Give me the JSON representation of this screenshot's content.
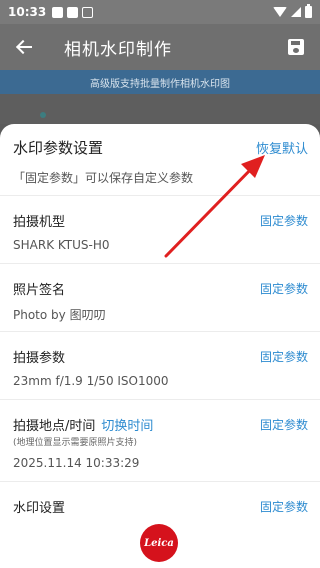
{
  "status_bar": {
    "time": "10:33",
    "icons": [
      "notification-icon",
      "notification-icon",
      "a-icon",
      "wifi-icon",
      "signal-icon",
      "battery-icon"
    ]
  },
  "app_bar": {
    "title": "相机水印制作",
    "icons": [
      "back-arrow-icon",
      "save-icon"
    ]
  },
  "banner": {
    "text": "高级版支持批量制作相机水印图"
  },
  "sheet": {
    "title": "水印参数设置",
    "restore_label": "恢复默认",
    "subtitle": "「固定参数」可以保存自定义参数",
    "rows": [
      {
        "label": "拍摄机型",
        "value": "SHARK KTUS-H0",
        "action": "固定参数"
      },
      {
        "label": "照片签名",
        "value": "Photo by 图叨叨",
        "action": "固定参数"
      },
      {
        "label": "拍摄参数",
        "value": "23mm f/1.9 1/50 ISO1000",
        "action": "固定参数"
      },
      {
        "label": "拍摄地点/时间",
        "inline_link": "切换时间",
        "note": "(地理位置显示需要原照片支持)",
        "value": "2025.11.14 10:33:29",
        "action": "固定参数"
      },
      {
        "label": "水印设置",
        "action": "固定参数"
      }
    ],
    "logo_text": "Leica"
  },
  "colors": {
    "accent": "#2d8bd0",
    "banner_bg": "#3c6a92",
    "arrow": "#e02020",
    "logo": "#d5121c"
  }
}
